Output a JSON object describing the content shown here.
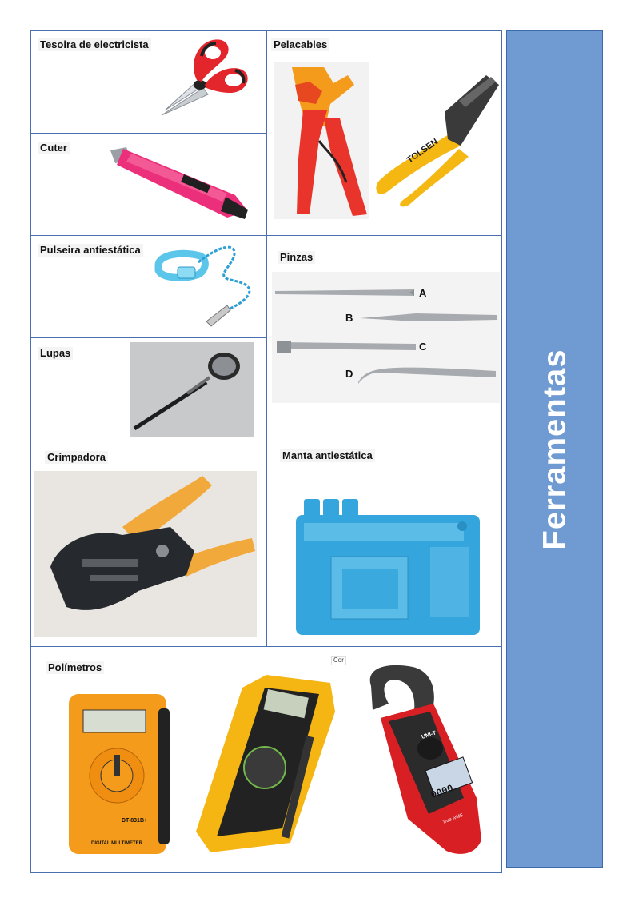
{
  "side_title": "Ferramentas",
  "cells": {
    "tesoira": "Tesoira de electricista",
    "pelacables": "Pelacables",
    "cuter": "Cuter",
    "pulseira": "Pulseira antiestática",
    "pinzas": "Pinzas",
    "lupas": "Lupas",
    "crimpadora": "Crimpadora",
    "manta": "Manta antiestática",
    "polimetros": "Polímetros"
  },
  "pinzas_letters": [
    "A",
    "B",
    "C",
    "D"
  ],
  "tool_prints": {
    "tolsen": "TOLSEN",
    "multimeter_model": "DT-831B+",
    "multimeter_caption": "DIGITAL MULTIMETER",
    "meter_display": "0000",
    "clamp_brand": "UNI-T",
    "clamp_caption": "True RMS",
    "cut_tag": "Cor"
  }
}
